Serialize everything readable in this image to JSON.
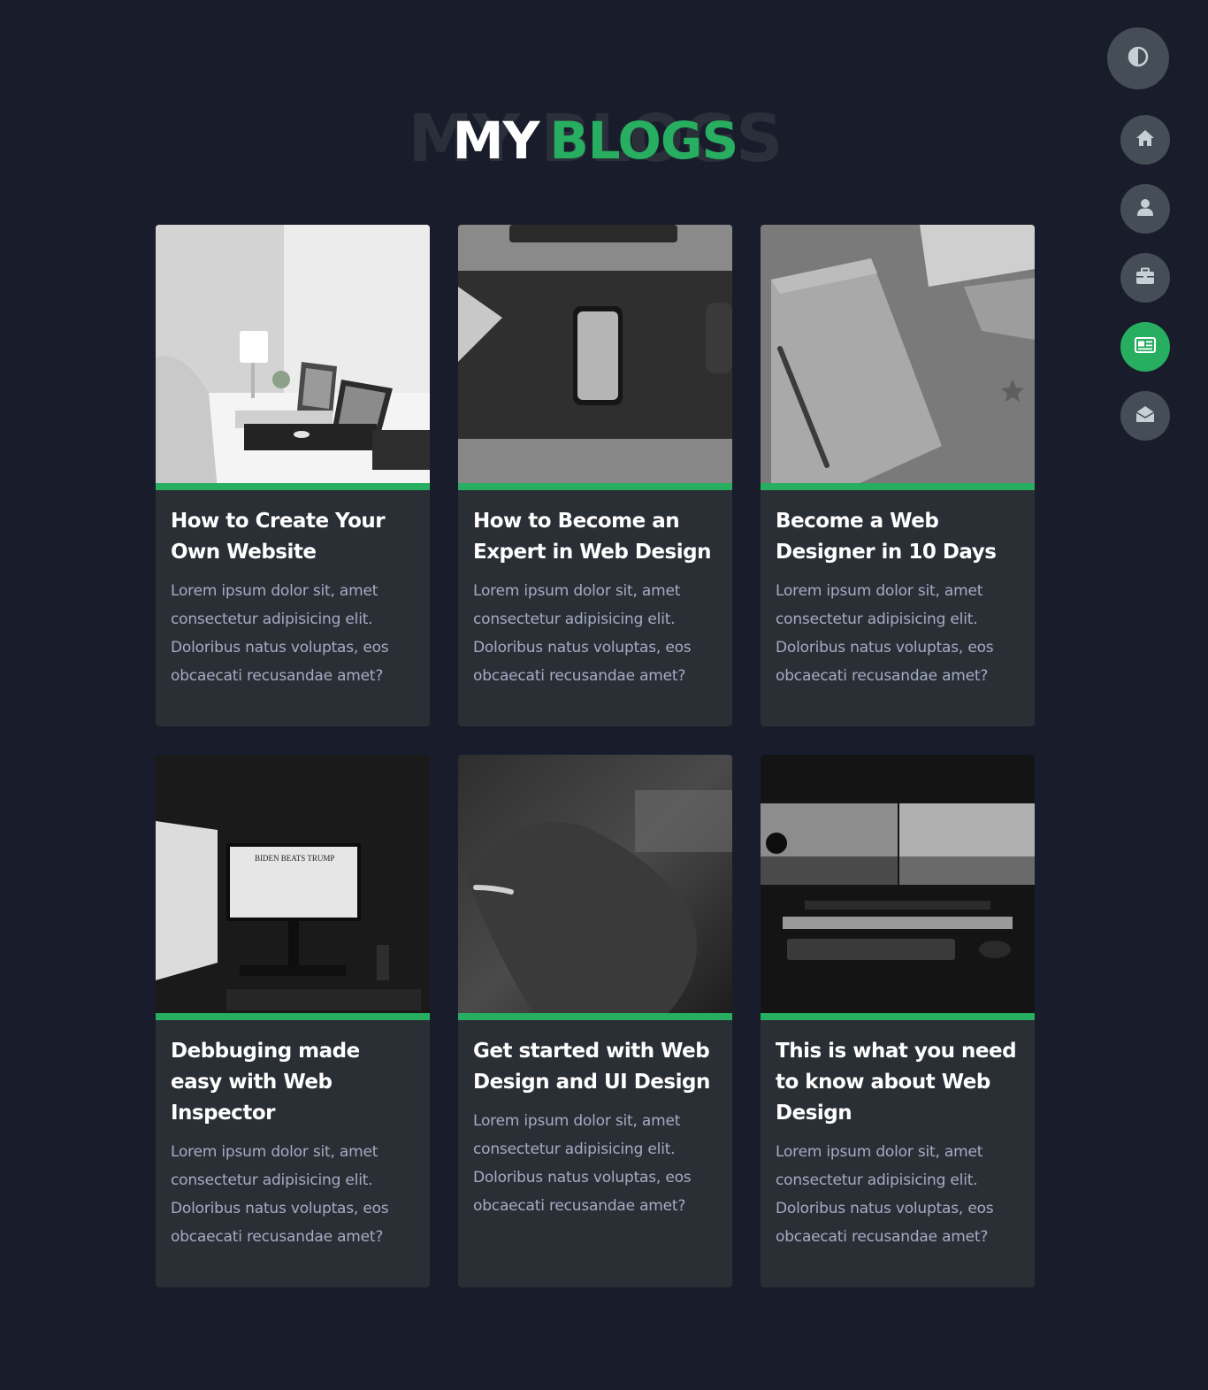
{
  "header": {
    "bg_text": "MY BLOGS",
    "word1": "MY",
    "word2": "BLOGS"
  },
  "controls": {
    "theme_toggle_icon": "contrast-icon",
    "nav": [
      {
        "icon": "home-icon",
        "active": false
      },
      {
        "icon": "user-icon",
        "active": false
      },
      {
        "icon": "briefcase-icon",
        "active": false
      },
      {
        "icon": "newspaper-icon",
        "active": true
      },
      {
        "icon": "envelope-open-icon",
        "active": false
      }
    ]
  },
  "colors": {
    "background": "#191d2b",
    "accent": "#27ae60",
    "card": "#2a2e35",
    "nav_button": "#454e56"
  },
  "blogs": [
    {
      "title": "How to Create Your Own Website",
      "text": "Lorem ipsum dolor sit, amet consectetur adipisicing elit. Doloribus natus voluptas, eos obcaecati recusandae amet?"
    },
    {
      "title": "How to Become an Expert in Web Design",
      "text": "Lorem ipsum dolor sit, amet consectetur adipisicing elit. Doloribus natus voluptas, eos obcaecati recusandae amet?"
    },
    {
      "title": "Become a Web Designer in 10 Days",
      "text": "Lorem ipsum dolor sit, amet consectetur adipisicing elit. Doloribus natus voluptas, eos obcaecati recusandae amet?"
    },
    {
      "title": "Debbuging made easy with Web Inspector",
      "text": "Lorem ipsum dolor sit, amet consectetur adipisicing elit. Doloribus natus voluptas, eos obcaecati recusandae amet?"
    },
    {
      "title": "Get started with Web Design and UI Design",
      "text": "Lorem ipsum dolor sit, amet consectetur adipisicing elit. Doloribus natus voluptas, eos obcaecati recusandae amet?"
    },
    {
      "title": "This is what you need to know about Web Design",
      "text": "Lorem ipsum dolor sit, amet consectetur adipisicing elit. Doloribus natus voluptas, eos obcaecati recusandae amet?"
    }
  ]
}
